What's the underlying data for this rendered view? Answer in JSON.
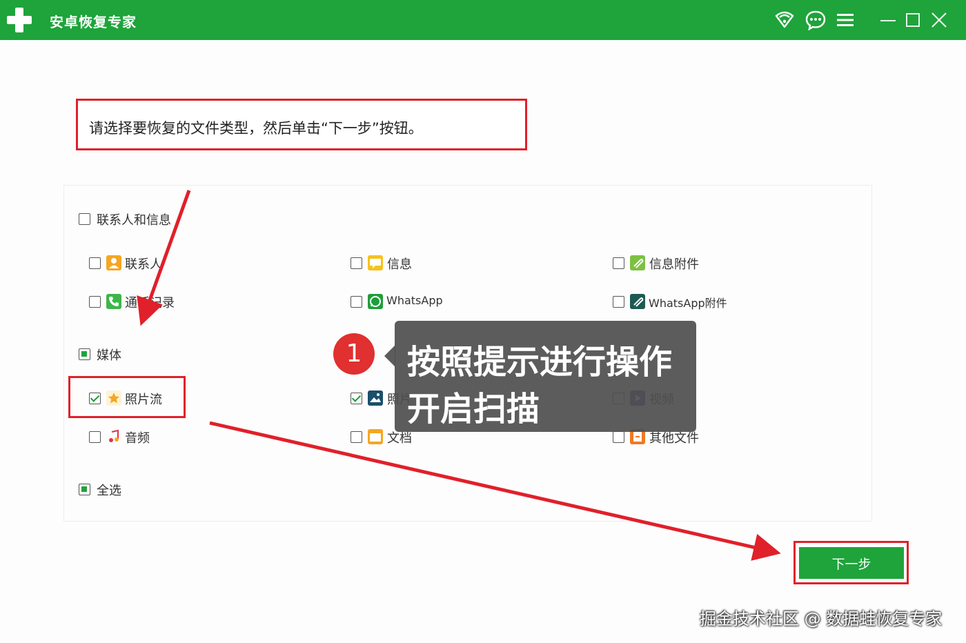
{
  "app": {
    "title": "安卓恢复专家"
  },
  "colors": {
    "brand_green": "#1ea43a",
    "highlight_red": "#e0202a"
  },
  "toolbar_icons": [
    "wifi-icon",
    "feedback-icon",
    "menu-icon",
    "minimize-icon",
    "maximize-icon",
    "close-icon"
  ],
  "instruction": "请选择要恢复的文件类型，然后单击“下一步”按钮。",
  "groups": {
    "contacts": {
      "label": "联系人和信息",
      "state": "unchecked"
    },
    "media": {
      "label": "媒体",
      "state": "partial"
    },
    "select_all": {
      "label": "全选",
      "state": "partial"
    }
  },
  "items": {
    "contacts": {
      "label": "联系人",
      "checked": false
    },
    "messages": {
      "label": "信息",
      "checked": false
    },
    "message_attachments": {
      "label": "信息附件",
      "checked": false
    },
    "call_log": {
      "label": "通话记录",
      "checked": false
    },
    "whatsapp": {
      "label": "WhatsApp",
      "checked": false
    },
    "whatsapp_attachments": {
      "label": "WhatsApp附件",
      "checked": false
    },
    "photo_stream": {
      "label": "照片流",
      "checked": true
    },
    "photos": {
      "label": "照片",
      "checked": true
    },
    "video": {
      "label": "视频",
      "checked": false
    },
    "audio": {
      "label": "音频",
      "checked": false
    },
    "documents": {
      "label": "文档",
      "checked": false
    },
    "other_files": {
      "label": "其他文件",
      "checked": false
    }
  },
  "next_button": {
    "label": "下一步"
  },
  "annotation": {
    "step": "1",
    "line1": "按照提示进行操作",
    "line2": "开启扫描"
  },
  "watermark": "掘金技术社区 @ 数据蛙恢复专家"
}
